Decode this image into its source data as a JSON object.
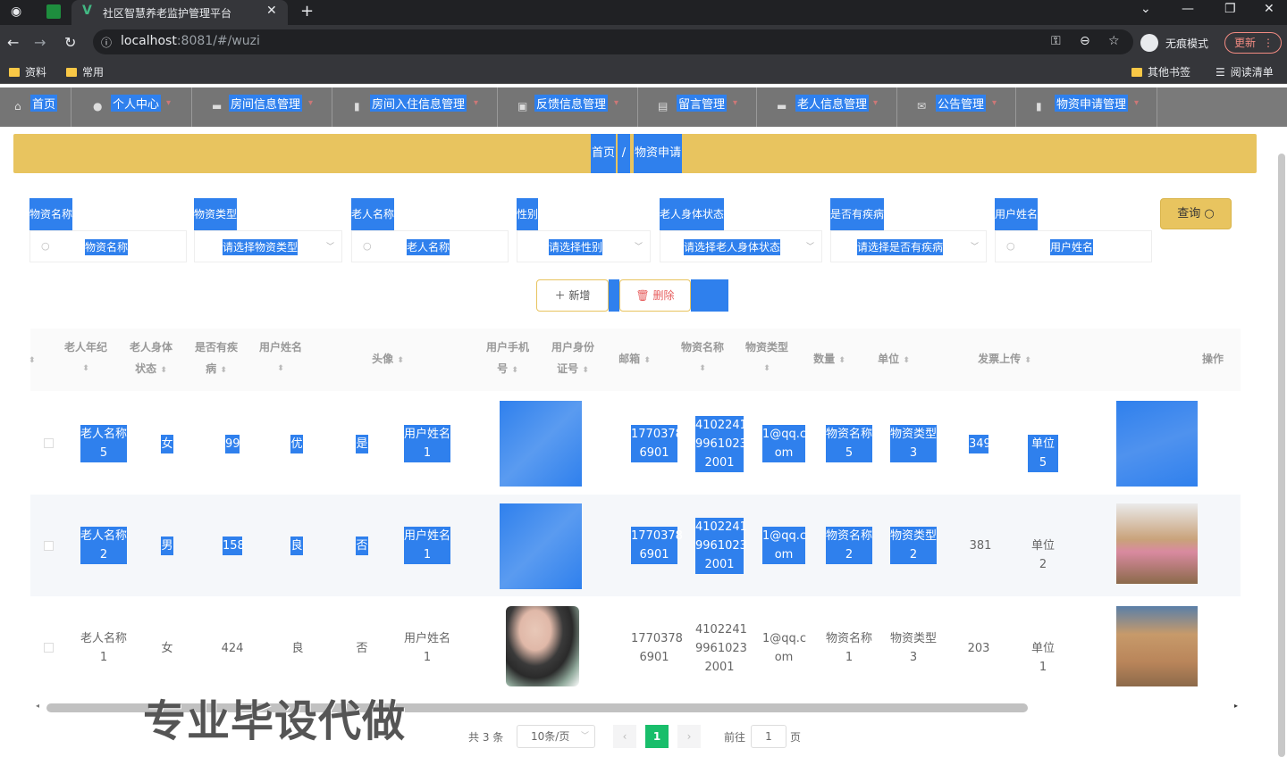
{
  "browser": {
    "tab_title": "社区智慧养老监护管理平台",
    "url_host": "localhost",
    "url_rest": ":8081/#/wuzi",
    "incognito_label": "无痕模式",
    "update_label": "更新",
    "bookmarks": [
      "资料",
      "常用"
    ],
    "bookmarks_right": [
      "其他书签",
      "阅读清单"
    ]
  },
  "nav": {
    "items": [
      {
        "label": "首页",
        "icon": "home-icon"
      },
      {
        "label": "个人中心",
        "icon": "user-icon"
      },
      {
        "label": "房间信息管理",
        "icon": "room-icon"
      },
      {
        "label": "房间入住信息管理",
        "icon": "checkin-icon"
      },
      {
        "label": "反馈信息管理",
        "icon": "feedback-icon"
      },
      {
        "label": "留言管理",
        "icon": "message-icon"
      },
      {
        "label": "老人信息管理",
        "icon": "elder-icon"
      },
      {
        "label": "公告管理",
        "icon": "notice-icon"
      },
      {
        "label": "物资申请管理",
        "icon": "supply-icon"
      }
    ]
  },
  "breadcrumb": {
    "home": "首页",
    "sep": "/",
    "current": "物资申请"
  },
  "filters": [
    {
      "label": "物资名称",
      "placeholder": "物资名称"
    },
    {
      "label": "物资类型",
      "placeholder": "请选择物资类型"
    },
    {
      "label": "老人名称",
      "placeholder": "老人名称"
    },
    {
      "label": "性别",
      "placeholder": "请选择性别"
    },
    {
      "label": "老人身体状态",
      "placeholder": "请选择老人身体状态"
    },
    {
      "label": "是否有疾病",
      "placeholder": "请选择是否有疾病"
    },
    {
      "label": "用户姓名",
      "placeholder": "用户姓名"
    }
  ],
  "buttons": {
    "query": "查询",
    "add": "新增",
    "delete": "删除"
  },
  "table": {
    "headers": [
      {
        "line1": "老人年纪",
        "line2": ""
      },
      {
        "line1": "老人身体",
        "line2": "状态"
      },
      {
        "line1": "是否有疾",
        "line2": "病"
      },
      {
        "line1": "用户姓名",
        "line2": ""
      },
      {
        "line1": "头像",
        "line2": ""
      },
      {
        "line1": "用户手机",
        "line2": "号"
      },
      {
        "line1": "用户身份",
        "line2": "证号"
      },
      {
        "line1": "邮箱",
        "line2": ""
      },
      {
        "line1": "物资名称",
        "line2": ""
      },
      {
        "line1": "物资类型",
        "line2": ""
      },
      {
        "line1": "数量",
        "line2": ""
      },
      {
        "line1": "单位",
        "line2": ""
      },
      {
        "line1": "发票上传",
        "line2": ""
      },
      {
        "line1": "操作",
        "line2": ""
      }
    ],
    "rows": [
      {
        "elder_name": [
          "老人名称",
          "5"
        ],
        "gender": "女",
        "age": "99",
        "status": "优",
        "disease": "是",
        "user_name": [
          "用户姓名",
          "1"
        ],
        "phone": [
          "1770378",
          "6901"
        ],
        "id_no": [
          "4102241",
          "9961023",
          "2001"
        ],
        "email": [
          "1@qq.c",
          "om"
        ],
        "supply_name": [
          "物资名称",
          "5"
        ],
        "supply_type": [
          "物资类型",
          "3"
        ],
        "qty": "349",
        "unit": "单位5"
      },
      {
        "elder_name": [
          "老人名称",
          "2"
        ],
        "gender": "男",
        "age": "158",
        "status": "良",
        "disease": "否",
        "user_name": [
          "用户姓名",
          "1"
        ],
        "phone": [
          "1770378",
          "6901"
        ],
        "id_no": [
          "4102241",
          "9961023",
          "2001"
        ],
        "email": [
          "1@qq.c",
          "om"
        ],
        "supply_name": [
          "物资名称",
          "2"
        ],
        "supply_type": [
          "物资类型",
          "2"
        ],
        "qty": "381",
        "unit": "单位2"
      },
      {
        "elder_name": [
          "老人名称",
          "1"
        ],
        "gender": "女",
        "age": "424",
        "status": "良",
        "disease": "否",
        "user_name": [
          "用户姓名",
          "1"
        ],
        "phone": [
          "1770378",
          "6901"
        ],
        "id_no": [
          "4102241",
          "9961023",
          "2001"
        ],
        "email": [
          "1@qq.c",
          "om"
        ],
        "supply_name": [
          "物资名称",
          "1"
        ],
        "supply_type": [
          "物资类型",
          "3"
        ],
        "qty": "203",
        "unit": "单位1"
      }
    ]
  },
  "watermark": "专业毕设代做",
  "pagination": {
    "total": "共 3 条",
    "page_size": "10条/页",
    "current": "1",
    "goto_prefix": "前往",
    "goto_value": "1",
    "goto_suffix": "页"
  },
  "colors": {
    "nav_bg": "#7a7a7a",
    "highlight": "#2f80ed",
    "accent": "#e8c45f",
    "pager_active": "#19be6b"
  }
}
